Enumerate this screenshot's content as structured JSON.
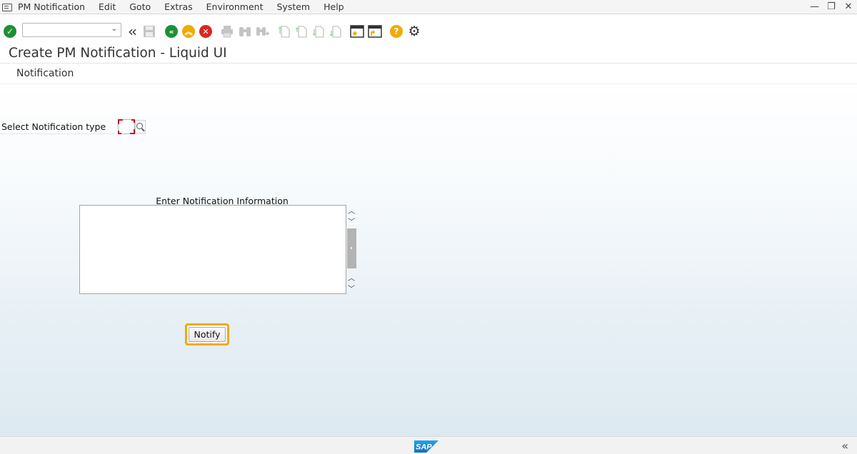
{
  "menubar": {
    "items": [
      "PM Notification",
      "Edit",
      "Goto",
      "Extras",
      "Environment",
      "System",
      "Help"
    ],
    "window_controls": {
      "minimize": "—",
      "restore": "❐",
      "close": "✕"
    }
  },
  "toolbar": {
    "command_field_value": "",
    "icons": [
      "enter-icon",
      "command-dropdown-icon",
      "collapse-toolbar-icon",
      "save-icon",
      "back-icon",
      "exit-icon",
      "cancel-icon",
      "print-icon",
      "find-icon",
      "find-next-icon",
      "first-page-icon",
      "previous-page-icon",
      "next-page-icon",
      "last-page-icon",
      "create-session-icon",
      "generate-shortcut-icon",
      "help-icon",
      "customize-layout-icon"
    ]
  },
  "title": "Create PM Notification - Liquid UI",
  "subtitle": "Notification",
  "form": {
    "notification_type_label": "Select Notification type",
    "notification_type_value": "",
    "notes_label": "Enter Notification Information",
    "notes_value": "",
    "notify_button": "Notify"
  },
  "statusbar": {
    "logo_text": "SAP",
    "collapse_glyph": "«"
  },
  "colors": {
    "accent_orange": "#f0ab00",
    "sap_blue": "#1a8fd6",
    "ok_green": "#1e8f35",
    "cancel_red": "#d9271e"
  }
}
